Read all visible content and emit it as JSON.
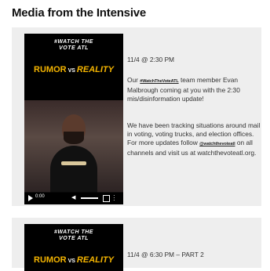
{
  "section": {
    "title": "Media from the Intensive"
  },
  "posts": [
    {
      "video": {
        "brand_top": "#WATCH THE",
        "brand_bottom": "VOTE ATL",
        "headline_rumor": "RUMOR",
        "headline_vs": "VS",
        "headline_reality": "REALITY",
        "time": "0:00"
      },
      "timestamp": "11/4 @ 2:30 PM",
      "para1_prefix": "Our ",
      "para1_tag": "#WatchTheVoteATL",
      "para1_suffix": " team member Evan Malbrough coming at you with the 2:30 mis/disinformation update!",
      "para2_prefix": "We have been tracking situations around mail in voting, voting trucks, and election offices. For more updates follow ",
      "para2_handle": "@watchthevoteatl",
      "para2_suffix": " on all channels and visit us at watchthevoteatl.org."
    },
    {
      "video": {
        "brand_top": "#WATCH THE",
        "brand_bottom": "VOTE ATL",
        "headline_rumor": "RUMOR",
        "headline_vs": "VS",
        "headline_reality": "REALITY"
      },
      "timestamp": "11/4 @ 6:30 PM – PART 2"
    }
  ],
  "colors": {
    "accent": "#f4b400",
    "card_bg": "#eeeeee",
    "crowd": "#4b2e6b"
  },
  "icons": [
    "play-icon",
    "volume-icon",
    "fullscreen-icon",
    "more-menu-icon"
  ]
}
